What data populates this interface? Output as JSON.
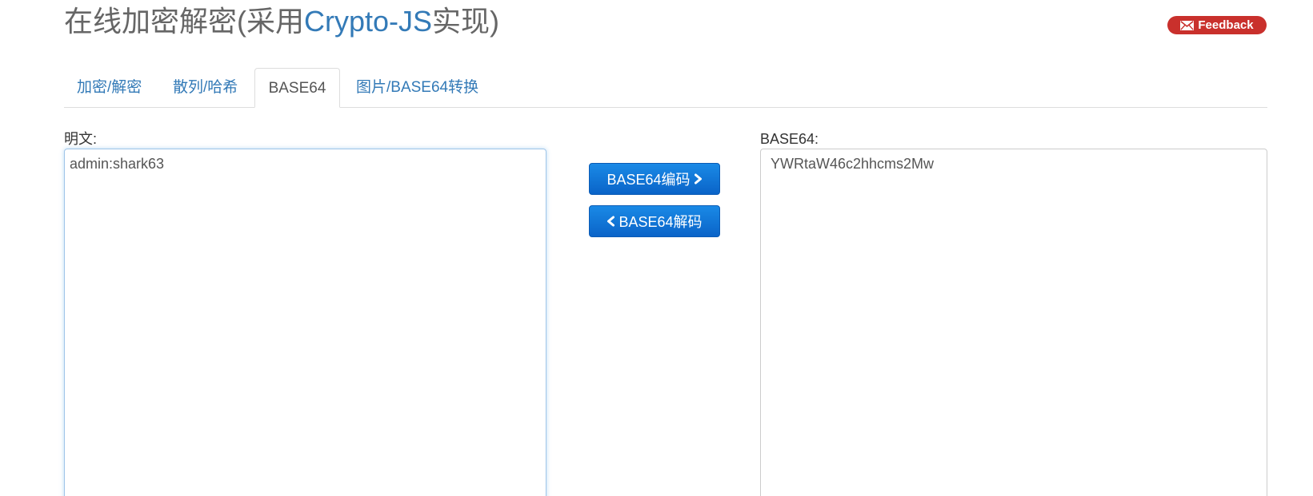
{
  "header": {
    "title_prefix": "在线加密解密(采用",
    "title_highlight": "Crypto-JS",
    "title_suffix": "实现)",
    "feedback_label": "Feedback"
  },
  "tabs": [
    {
      "label": "加密/解密",
      "active": false
    },
    {
      "label": "散列/哈希",
      "active": false
    },
    {
      "label": "BASE64",
      "active": true
    },
    {
      "label": "图片/BASE64转换",
      "active": false
    }
  ],
  "plain": {
    "label": "明文:",
    "value": "admin:shark63"
  },
  "base64": {
    "label": "BASE64:",
    "value": "YWRtaW46c2hhcms2Mw"
  },
  "actions": {
    "encode_label": "BASE64编码",
    "decode_label": "BASE64解码"
  },
  "icons": {
    "feedback": "envelope-icon",
    "encode": "chevron-right-icon",
    "decode": "chevron-left-icon"
  },
  "colors": {
    "link": "#337ab7",
    "feedback_bg": "#c9302c",
    "button_bg": "#0a64c8",
    "title": "#666666"
  }
}
